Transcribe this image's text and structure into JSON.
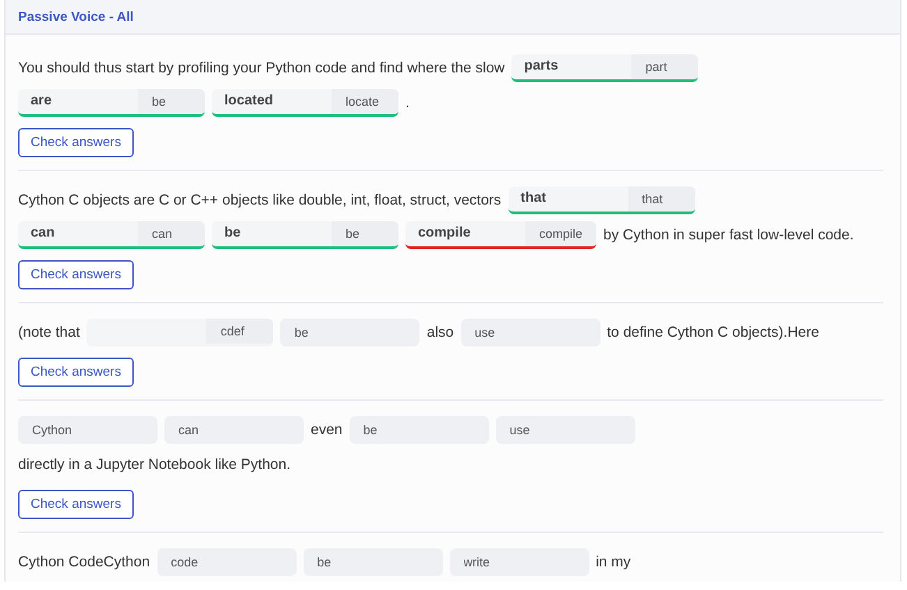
{
  "header": {
    "title": "Passive Voice - All"
  },
  "exercises": [
    {
      "parts": [
        {
          "kind": "text",
          "text": "You should thus start by profiling your Python code and find where the slow"
        },
        {
          "kind": "blank",
          "value": "parts",
          "hint": "part",
          "correct": true
        },
        {
          "kind": "blank",
          "value": "are",
          "hint": "be",
          "correct": true
        },
        {
          "kind": "blank",
          "value": "located",
          "hint": "locate",
          "correct": true
        },
        {
          "kind": "text",
          "text": "."
        }
      ],
      "button": "Check answers"
    },
    {
      "parts": [
        {
          "kind": "text",
          "text": "Cython C objects are C or C++ objects like double, int, float, struct, vectors"
        },
        {
          "kind": "blank",
          "value": "that",
          "hint": "that",
          "correct": true
        },
        {
          "kind": "blank",
          "value": "can",
          "hint": "can",
          "correct": true
        },
        {
          "kind": "blank",
          "value": "be",
          "hint": "be",
          "correct": true
        },
        {
          "kind": "blank",
          "value": "compile",
          "hint": "compile",
          "correct": false
        },
        {
          "kind": "text",
          "text": "by Cython in super fast low-level code."
        }
      ],
      "button": "Check answers"
    },
    {
      "parts": [
        {
          "kind": "text",
          "text": "(note that"
        },
        {
          "kind": "blank",
          "hint": "cdef"
        },
        {
          "kind": "field",
          "placeholder": "be"
        },
        {
          "kind": "text",
          "text": "also"
        },
        {
          "kind": "field",
          "placeholder": "use"
        },
        {
          "kind": "text",
          "text": "to define Cython C objects).Here"
        }
      ],
      "button": "Check answers"
    },
    {
      "parts": [
        {
          "kind": "field",
          "placeholder": "Cython"
        },
        {
          "kind": "field",
          "placeholder": "can"
        },
        {
          "kind": "text",
          "text": "even"
        },
        {
          "kind": "field",
          "placeholder": "be"
        },
        {
          "kind": "field",
          "placeholder": "use"
        },
        {
          "kind": "text",
          "text": "directly in a Jupyter Notebook like Python."
        }
      ],
      "button": "Check answers"
    },
    {
      "parts": [
        {
          "kind": "text",
          "text": "Cython CodeCython"
        },
        {
          "kind": "field",
          "placeholder": "code"
        },
        {
          "kind": "field",
          "placeholder": "be"
        },
        {
          "kind": "field",
          "placeholder": "write"
        },
        {
          "kind": "text",
          "text": "in my"
        }
      ]
    }
  ]
}
